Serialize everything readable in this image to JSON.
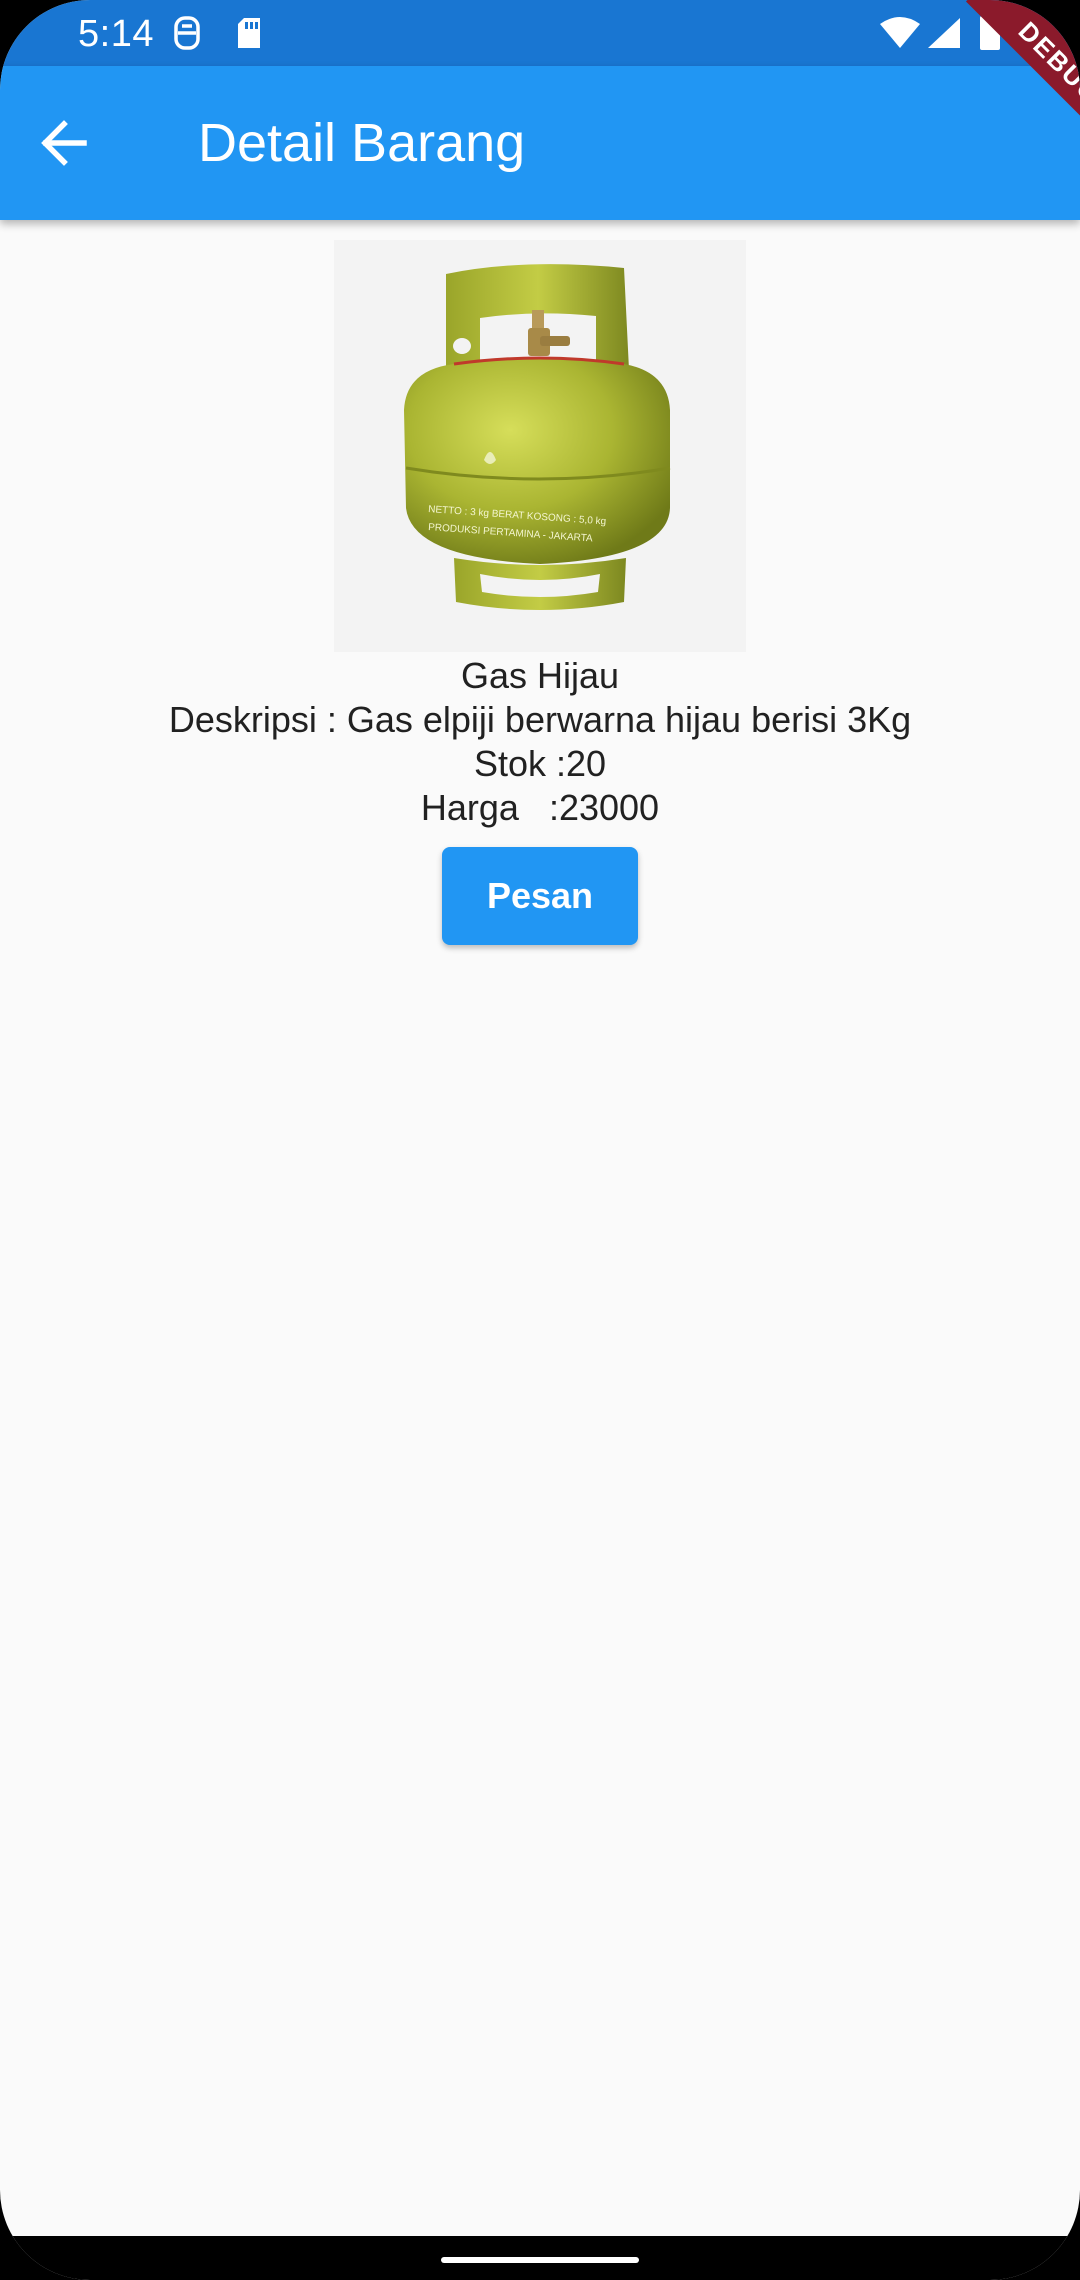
{
  "status_bar": {
    "time": "5:14",
    "icons": [
      "vpn-icon",
      "sd-card-icon",
      "wifi-icon",
      "signal-icon",
      "battery-icon"
    ]
  },
  "app_bar": {
    "back_icon": "arrow-back-icon",
    "title": "Detail Barang"
  },
  "debug_banner": {
    "label": "DEBUG",
    "color": "#8b1a2b"
  },
  "product": {
    "image_icon": "gas-cylinder-image",
    "name": "Gas Hijau",
    "description": "Deskripsi : Gas elpiji berwarna hijau berisi 3Kg",
    "stock": "Stok :20",
    "price": "Harga   :23000",
    "order_button": "Pesan"
  },
  "colors": {
    "primary": "#2196f3",
    "status_bar": "#1976d2",
    "background": "#fafafa",
    "text": "#212121"
  }
}
